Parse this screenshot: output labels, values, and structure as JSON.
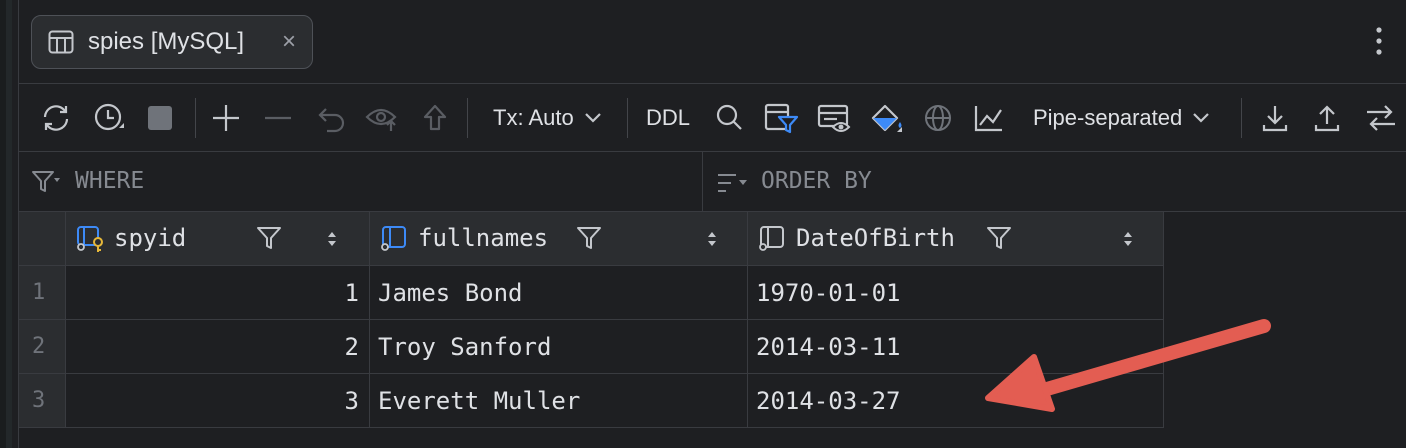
{
  "tab": {
    "title": "spies [MySQL]",
    "icon": "table-icon",
    "close": "×"
  },
  "toolbar": {
    "tx_mode": "Tx: Auto",
    "ddl_label": "DDL",
    "export_format": "Pipe-separated",
    "icons": [
      "refresh-icon",
      "history-icon",
      "stop-icon",
      "add-row-icon",
      "delete-row-icon",
      "revert-icon",
      "preview-pending-icon",
      "submit-icon",
      "tx-dropdown-chevron-icon",
      "search-icon",
      "filter-view-icon",
      "data-view-icon",
      "paint-icon",
      "globe-icon",
      "chart-icon",
      "format-chevron-icon",
      "download-icon",
      "upload-icon",
      "compare-icon"
    ]
  },
  "filters": {
    "where_label": "WHERE",
    "order_label": "ORDER BY"
  },
  "table": {
    "columns": [
      {
        "name": "spyid",
        "icon": "primary-key-column-icon"
      },
      {
        "name": "fullnames",
        "icon": "column-icon"
      },
      {
        "name": "DateOfBirth",
        "icon": "column-icon"
      }
    ],
    "rows": [
      {
        "num": "1",
        "spyid": "1",
        "fullnames": "James Bond",
        "dob": "1970-01-01"
      },
      {
        "num": "2",
        "spyid": "2",
        "fullnames": "Troy Sanford",
        "dob": "2014-03-11"
      },
      {
        "num": "3",
        "spyid": "3",
        "fullnames": "Everett Muller",
        "dob": "2014-03-27"
      }
    ]
  },
  "annotation": {
    "type": "arrow",
    "color": "#e35d52",
    "points_to": "rows.2.dob"
  }
}
